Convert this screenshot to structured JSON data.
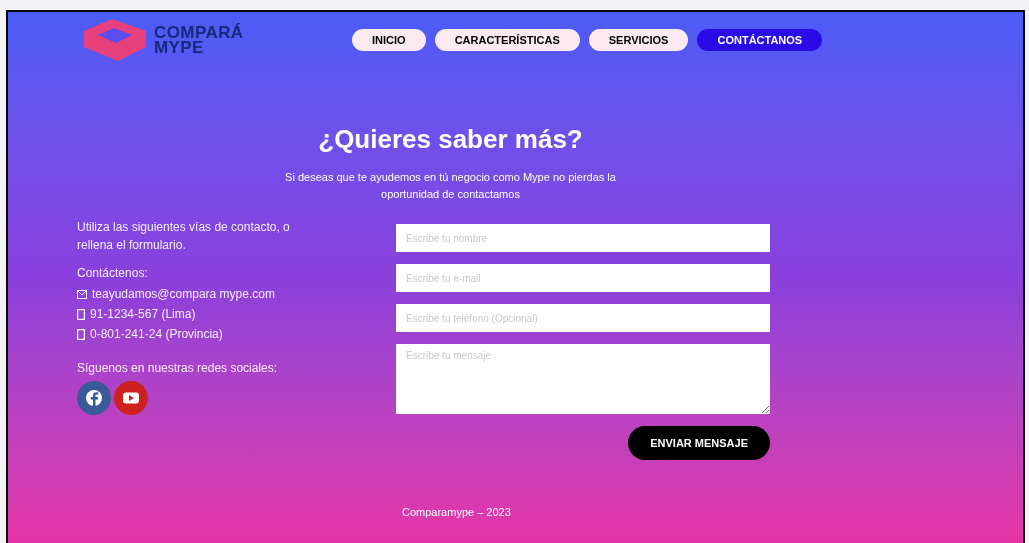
{
  "brand": {
    "line1": "COMPARÁ",
    "line2": "MYPE"
  },
  "nav": [
    {
      "label": "INICIO",
      "selected": false
    },
    {
      "label": "CARACTERÍSTICAS",
      "selected": false
    },
    {
      "label": "SERVICIOS",
      "selected": false
    },
    {
      "label": "CONTÁCTANOS",
      "selected": true
    }
  ],
  "hero": {
    "title": "¿Quieres saber más?",
    "subtitle": "Si deseas que te ayudemos en tú negocio como Mype  no pierdas la oportunidad de contactamos"
  },
  "contact": {
    "intro": "Utiliza las siguientes vías de contacto, o rellena el formulario.",
    "heading": "Contáctenos:",
    "items": [
      {
        "kind": "email",
        "text": "teayudamos@compara mype.com"
      },
      {
        "kind": "phone",
        "text": "91-1234-567 (Lima)"
      },
      {
        "kind": "phone",
        "text": "0-801-241-24 (Provincia)"
      }
    ],
    "social_heading": "Síguenos en nuestras redes sociales:",
    "social": [
      {
        "kind": "facebook",
        "color": "#3b5998"
      },
      {
        "kind": "youtube",
        "color": "#cd201f"
      }
    ]
  },
  "form": {
    "fields": [
      {
        "kind": "input",
        "placeholder": "Escribe tu nombre"
      },
      {
        "kind": "input",
        "placeholder": "Escribe tu e-mail"
      },
      {
        "kind": "input",
        "placeholder": "Escribe tu teléfono (Opcional)"
      },
      {
        "kind": "textarea",
        "placeholder": "Escribe tu mensaje"
      }
    ],
    "submit": "ENVIAR MENSAJE"
  },
  "footer": "Comparamype – 2023"
}
